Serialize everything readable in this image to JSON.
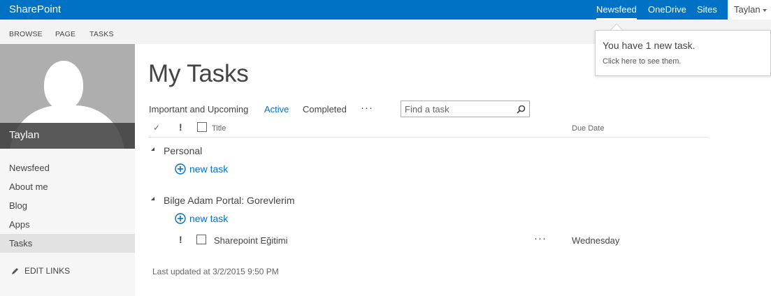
{
  "suite": {
    "brand": "SharePoint",
    "nav": [
      {
        "label": "Newsfeed",
        "active": true
      },
      {
        "label": "OneDrive",
        "active": false
      },
      {
        "label": "Sites",
        "active": false
      }
    ],
    "user": "Taylan"
  },
  "ribbon": {
    "tabs": [
      "BROWSE",
      "PAGE",
      "TASKS"
    ]
  },
  "sidebar": {
    "name": "Taylan",
    "items": [
      {
        "label": "Newsfeed"
      },
      {
        "label": "About me"
      },
      {
        "label": "Blog"
      },
      {
        "label": "Apps"
      },
      {
        "label": "Tasks",
        "selected": true
      }
    ],
    "edit_links": "EDIT LINKS"
  },
  "main": {
    "title": "My Tasks",
    "views": [
      {
        "label": "Important and Upcoming",
        "active": false
      },
      {
        "label": "Active",
        "active": true
      },
      {
        "label": "Completed",
        "active": false
      }
    ],
    "more": "···",
    "search": {
      "placeholder": "Find a task",
      "value": ""
    },
    "columns": {
      "check": "✓",
      "importance": "!",
      "title": "Title",
      "due": "Due Date"
    },
    "groups": [
      {
        "name": "Personal",
        "new_task": "new task",
        "tasks": []
      },
      {
        "name": "Bilge Adam Portal: Gorevlerim",
        "new_task": "new task",
        "tasks": [
          {
            "importance": "!",
            "title": "Sharepoint Eğitimi",
            "more": "···",
            "due": "Wednesday"
          }
        ]
      }
    ],
    "last_updated": "Last updated at 3/2/2015 9:50 PM"
  },
  "notification": {
    "message": "You have 1 new task.",
    "sub": "Click here to see them."
  },
  "colors": {
    "accent": "#0072c6",
    "ribbon_bg": "#f3f3f3",
    "sidebar_bg": "#f6f6f6",
    "selected_bg": "#e2e2e2"
  }
}
